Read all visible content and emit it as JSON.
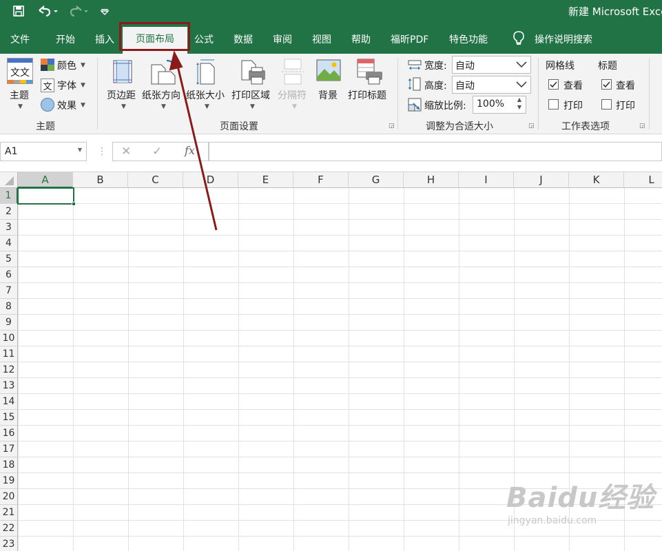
{
  "window": {
    "title": "新建 Microsoft Exce"
  },
  "tabs": [
    {
      "label": "文件"
    },
    {
      "label": "开始"
    },
    {
      "label": "插入"
    },
    {
      "label": "页面布局",
      "active": true
    },
    {
      "label": "公式"
    },
    {
      "label": "数据"
    },
    {
      "label": "审阅"
    },
    {
      "label": "视图"
    },
    {
      "label": "帮助"
    },
    {
      "label": "福昕PDF"
    },
    {
      "label": "特色功能"
    },
    {
      "label": "操作说明搜索"
    }
  ],
  "ribbon": {
    "theme": {
      "main_label": "主题",
      "colors_label": "颜色",
      "fonts_label": "字体",
      "effects_label": "效果",
      "theme_icon_text": "文文",
      "fonts_icon_text": "文",
      "group_label": "主题"
    },
    "page_setup": {
      "margins_label": "页边距",
      "orientation_label": "纸张方向",
      "size_label": "纸张大小",
      "print_area_label": "打印区域",
      "breaks_label": "分隔符",
      "background_label": "背景",
      "print_titles_label": "打印标题",
      "group_label": "页面设置"
    },
    "scale_to_fit": {
      "width_label": "宽度:",
      "width_value": "自动",
      "height_label": "高度:",
      "height_value": "自动",
      "scale_label": "缩放比例:",
      "scale_value": "100%",
      "group_label": "调整为合适大小"
    },
    "sheet_options": {
      "gridlines_label": "网格线",
      "headings_label": "标题",
      "view_label": "查看",
      "print_label": "打印",
      "gridlines_view": true,
      "gridlines_print": false,
      "headings_view": true,
      "headings_print": false,
      "group_label": "工作表选项"
    }
  },
  "formula_bar": {
    "name_box": "A1",
    "formula": "",
    "fx_label": "fx"
  },
  "grid": {
    "columns": [
      "A",
      "B",
      "C",
      "D",
      "E",
      "F",
      "G",
      "H",
      "I",
      "J",
      "K",
      "L"
    ],
    "rows": [
      "1",
      "2",
      "3",
      "4",
      "5",
      "6",
      "7",
      "8",
      "9",
      "10",
      "11",
      "12",
      "13",
      "14",
      "15",
      "16",
      "17",
      "18",
      "19",
      "20",
      "21",
      "22",
      "23"
    ],
    "selected_cell": "A1"
  },
  "watermark": {
    "main": "Baidu经验",
    "sub": "jingyan.baidu.com"
  },
  "colors": {
    "excel_green": "#217346",
    "highlight_red": "#8b1a1a"
  }
}
